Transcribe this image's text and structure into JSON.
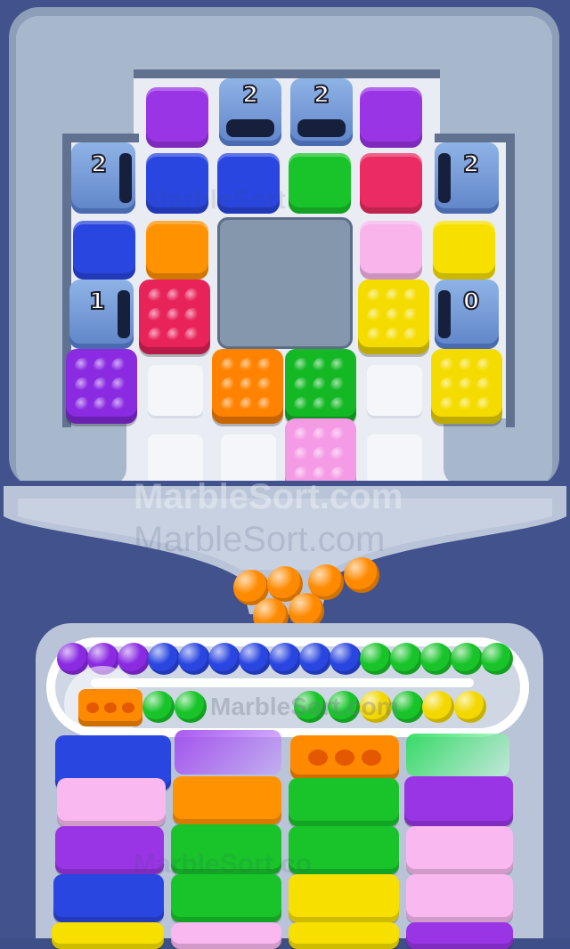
{
  "tunnels": [
    {
      "label": "2"
    },
    {
      "label": "2"
    },
    {
      "label": "2"
    },
    {
      "label": "2"
    },
    {
      "label": "1"
    },
    {
      "label": "0"
    }
  ],
  "watermarks": {
    "primary": "MarbleSort.com",
    "secondary": "MarbleSort.com",
    "faint1": "MarbleSort",
    "faint2": "MarbleSort.com",
    "faint3": "MarbleSort.co"
  },
  "conveyor": {
    "balls_top": [
      "purple",
      "purple",
      "purple",
      "blue",
      "blue",
      "blue",
      "blue",
      "blue",
      "blue",
      "blue",
      "green",
      "green",
      "green",
      "green",
      "green"
    ],
    "balls_bottom": [
      "green",
      "green",
      "green",
      "green",
      "yellow",
      "green",
      "yellow",
      "yellow"
    ]
  },
  "colors": {
    "purple": "#8a2be2",
    "blue": "#2a46e0",
    "green": "#19c42a",
    "red": "#e8235a",
    "orange": "#ff8a00",
    "yellow": "#f3d800",
    "pink": "#f7a3e8",
    "light_pink": "#f9b8ef"
  }
}
